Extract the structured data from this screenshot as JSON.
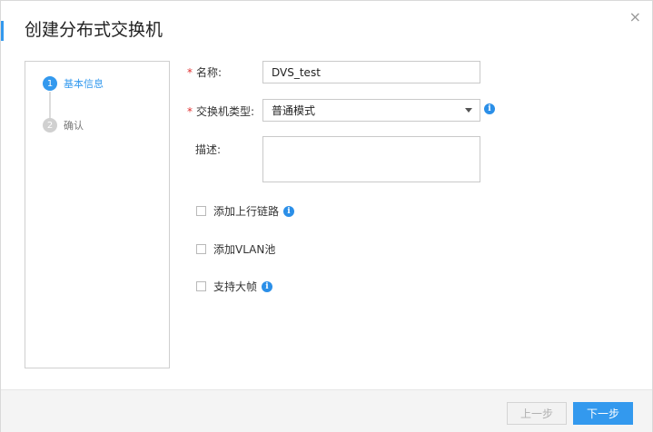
{
  "dialog": {
    "title": "创建分布式交换机",
    "close_symbol": "×"
  },
  "steps": [
    {
      "number": "1",
      "label": "基本信息",
      "active": true
    },
    {
      "number": "2",
      "label": "确认",
      "active": false
    }
  ],
  "form": {
    "required_mark": "*",
    "name": {
      "label": "名称:",
      "value": "DVS_test"
    },
    "switch_type": {
      "label": "交换机类型:",
      "selected": "普通模式"
    },
    "description": {
      "label": "描述:",
      "value": ""
    },
    "info_symbol": "i"
  },
  "options": [
    {
      "label": "添加上行链路",
      "checked": false,
      "has_info": true
    },
    {
      "label": "添加VLAN池",
      "checked": false,
      "has_info": false
    },
    {
      "label": "支持大帧",
      "checked": false,
      "has_info": true
    }
  ],
  "footer": {
    "prev_label": "上一步",
    "next_label": "下一步"
  },
  "colors": {
    "accent": "#3399ee",
    "required": "#e03030",
    "info": "#2b8fe8"
  }
}
